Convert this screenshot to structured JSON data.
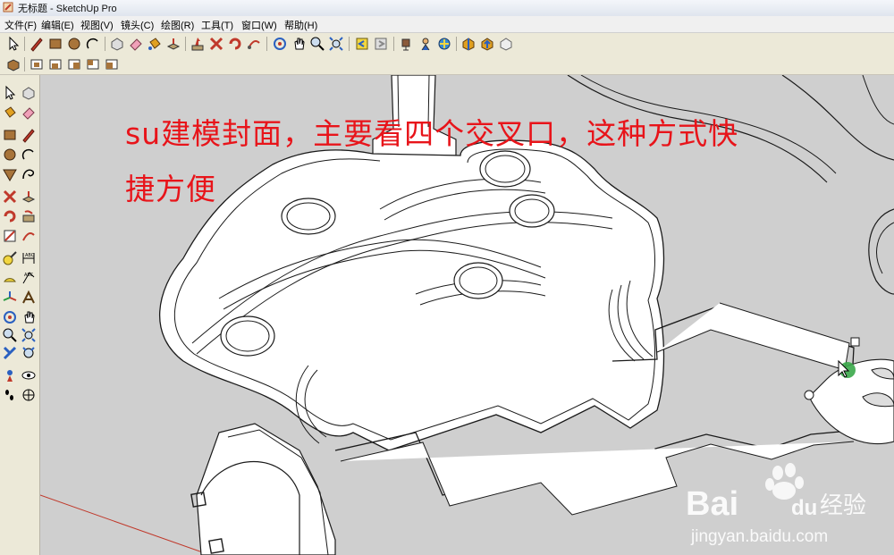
{
  "window": {
    "title": "无标题 - SketchUp Pro"
  },
  "menu": {
    "items": [
      "文件(F)",
      "编辑(E)",
      "视图(V)",
      "镜头(C)",
      "绘图(R)",
      "工具(T)",
      "窗口(W)",
      "帮助(H)"
    ]
  },
  "toolbar_main": {
    "icons": [
      "select-icon",
      "pencil-icon",
      "rectangle-icon",
      "circle-icon",
      "arc-icon",
      "make-component-icon",
      "eraser-icon",
      "paint-bucket-icon",
      "push-pull-icon",
      "move-icon",
      "rotate-icon",
      "follow-me-icon",
      "orbit-icon",
      "pan-icon",
      "zoom-icon",
      "zoom-extents-icon",
      "previous-view-icon",
      "next-view-icon",
      "position-camera-icon",
      "look-around-icon",
      "walk-icon",
      "get-models-icon",
      "share-model-icon",
      "components-icon"
    ]
  },
  "toolbar_views": {
    "icons": [
      "iso-view-icon",
      "top-view-icon",
      "front-view-icon",
      "right-view-icon",
      "back-view-icon",
      "left-view-icon"
    ]
  },
  "left_toolbar": {
    "icons": [
      "select-icon",
      "make-component-icon",
      "paint-bucket-icon",
      "eraser-icon",
      "rectangle-icon",
      "line-icon",
      "circle-icon",
      "arc-icon",
      "polygon-icon",
      "freehand-icon",
      "move-icon",
      "push-pull-icon",
      "rotate-icon",
      "follow-me-icon",
      "scale-icon",
      "offset-icon",
      "tape-measure-icon",
      "dimension-icon",
      "protractor-icon",
      "text-icon",
      "axes-icon",
      "3d-text-icon",
      "orbit-icon",
      "pan-icon",
      "zoom-icon",
      "zoom-window-icon",
      "zoom-extents-icon",
      "previous-view-icon",
      "position-camera-icon",
      "look-around-icon",
      "walk-icon",
      "section-plane-icon"
    ]
  },
  "overlay": {
    "line1": "su建模封面，主要看四个交叉口，这种方式快",
    "line2": "捷方便"
  },
  "watermark": {
    "brand": "Bai",
    "brand2": "du",
    "product": "经验",
    "url": "jingyan.baidu.com"
  },
  "colors": {
    "overlay_text": "#e8141a",
    "viewport_bg": "#cfcfcf",
    "plan_fill": "#ffffff",
    "line": "#1a1a1a"
  }
}
